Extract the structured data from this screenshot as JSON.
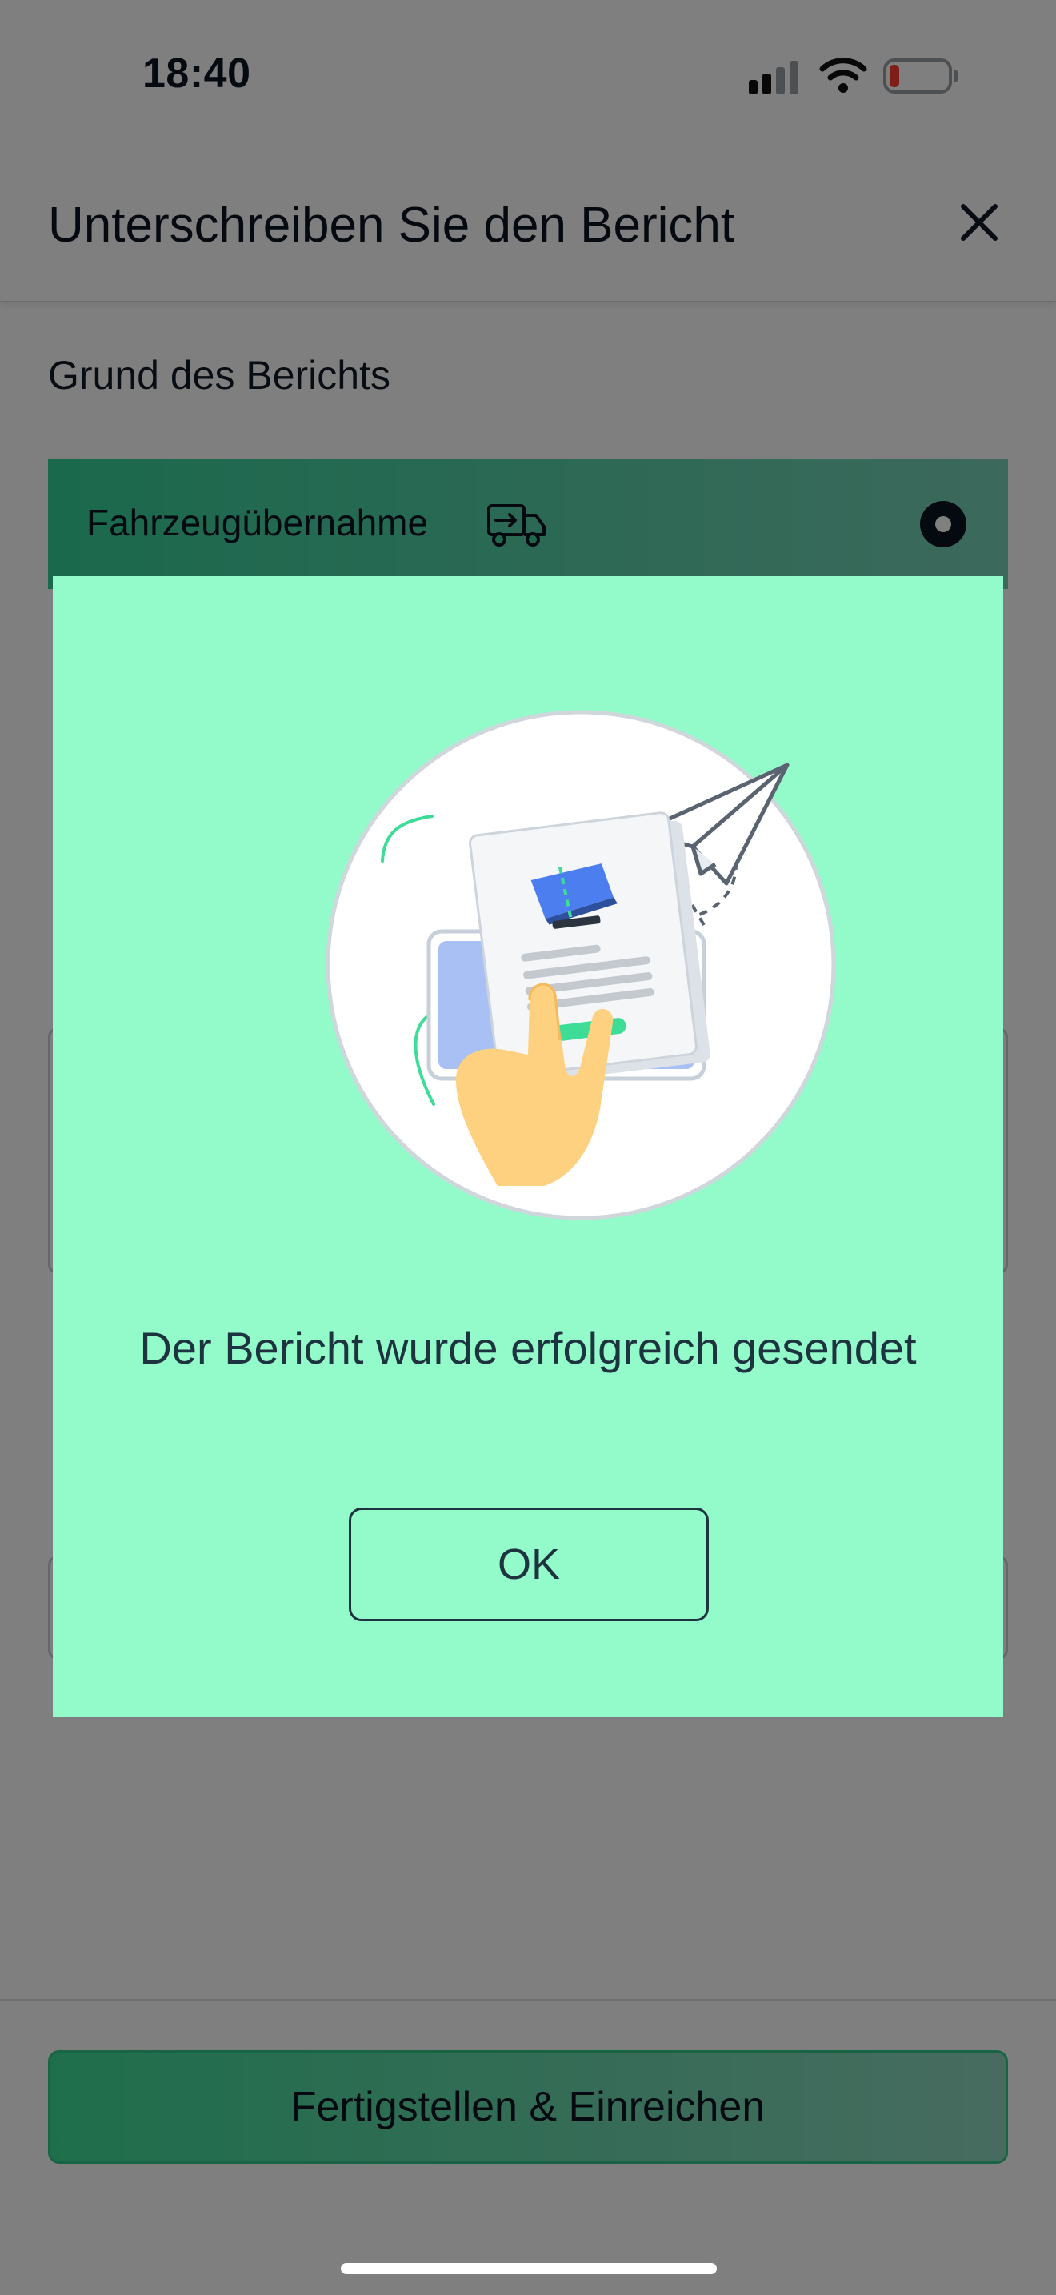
{
  "status_bar": {
    "time": "18:40",
    "icons": [
      "cellular-signal-icon",
      "wifi-icon",
      "battery-low-icon"
    ]
  },
  "header": {
    "title": "Unterschreiben Sie den Bericht",
    "close_icon": "close-icon"
  },
  "form": {
    "reason_section_label": "Grund des Berichts",
    "reason_option": {
      "label": "Fahrzeugübernahme",
      "icon": "truck-transfer-icon",
      "selected": true
    }
  },
  "footer": {
    "submit_label": "Fertigstellen & Einreichen"
  },
  "modal": {
    "message": "Der Bericht wurde erfolgreich gesendet",
    "ok_label": "OK",
    "illustration": "document-sent-paper-plane-illustration"
  },
  "colors": {
    "modal_background": "#93fac9",
    "accent_green": "#3ddc97",
    "text_dark": "#1e3340",
    "battery_low": "#ff3b30"
  }
}
